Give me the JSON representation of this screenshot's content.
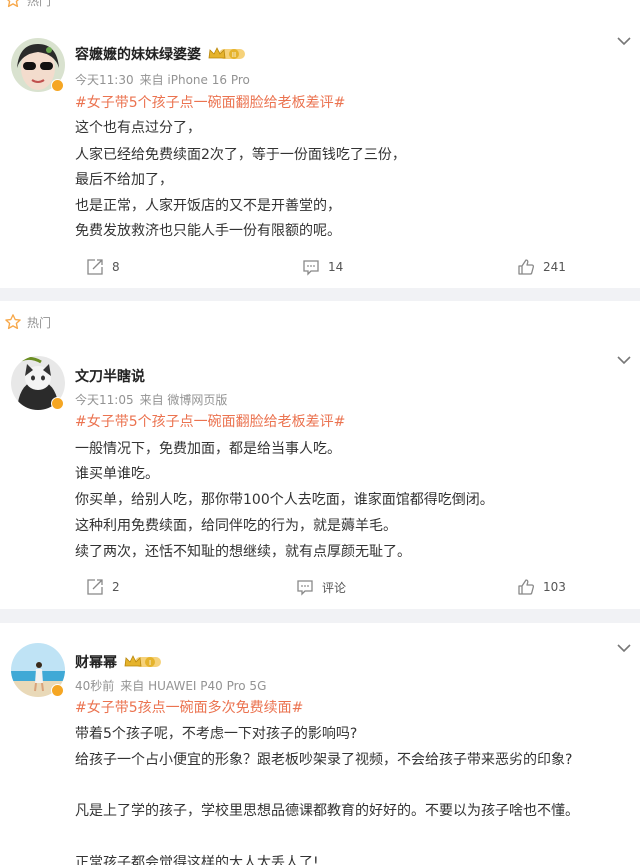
{
  "posts": [
    {
      "hot_label": "热门",
      "username": "容嬷嬷的妹妹绿婆婆",
      "level": "II",
      "time": "今天11:30",
      "source": "来自 iPhone 16 Pro",
      "topic": "#女子带5个孩子点一碗面翻脸给老板差评#",
      "lines": [
        "这个也有点过分了，",
        "人家已经给免费续面2次了，等于一份面钱吃了三份，",
        "最后不给加了，",
        "也是正常，人家开饭店的又不是开善堂的，",
        "免费发放救济也只能人手一份有限额的呢。"
      ],
      "repost": "8",
      "comment": "14",
      "like": "241"
    },
    {
      "hot_label": "热门",
      "username": "文刀半瞎说",
      "time": "今天11:05",
      "source": "来自 微博网页版",
      "topic": "#女子带5个孩子点一碗面翻脸给老板差评#",
      "lines": [
        "一般情况下，免费加面，都是给当事人吃。",
        "谁买单谁吃。",
        "你买单，给别人吃，那你带100个人去吃面，谁家面馆都得吃倒闭。",
        "这种利用免费续面，给同伴吃的行为，就是薅羊毛。",
        "续了两次，还恬不知耻的想继续，就有点厚颜无耻了。"
      ],
      "repost": "2",
      "comment": "评论",
      "like": "103"
    },
    {
      "username": "财幂幂",
      "level": "I",
      "time": "40秒前",
      "source": "来自 HUAWEI P40 Pro 5G",
      "topic": "#女子带5孩点一碗面多次免费续面#",
      "lines": [
        "带着5个孩子呢，不考虑一下对孩子的影响吗?",
        "给孩子一个占小便宜的形象？跟老板吵架录了视频，不会给孩子带来恶劣的印象?",
        "凡是上了学的孩子，学校里思想品德课都教育的好好的。不要以为孩子啥也不懂。",
        "正常孩子都会觉得这样的大人太丢人了!"
      ]
    }
  ],
  "colors": {
    "topic": "#eb7350",
    "hot_star": "#f7a84a",
    "verified_badge": "#f5a623",
    "crown_gold": "#e5b32c"
  },
  "icons": [
    "star-icon",
    "repost-icon",
    "comment-icon",
    "like-icon",
    "chevron-down-icon",
    "crown-icon",
    "verified-icon"
  ]
}
